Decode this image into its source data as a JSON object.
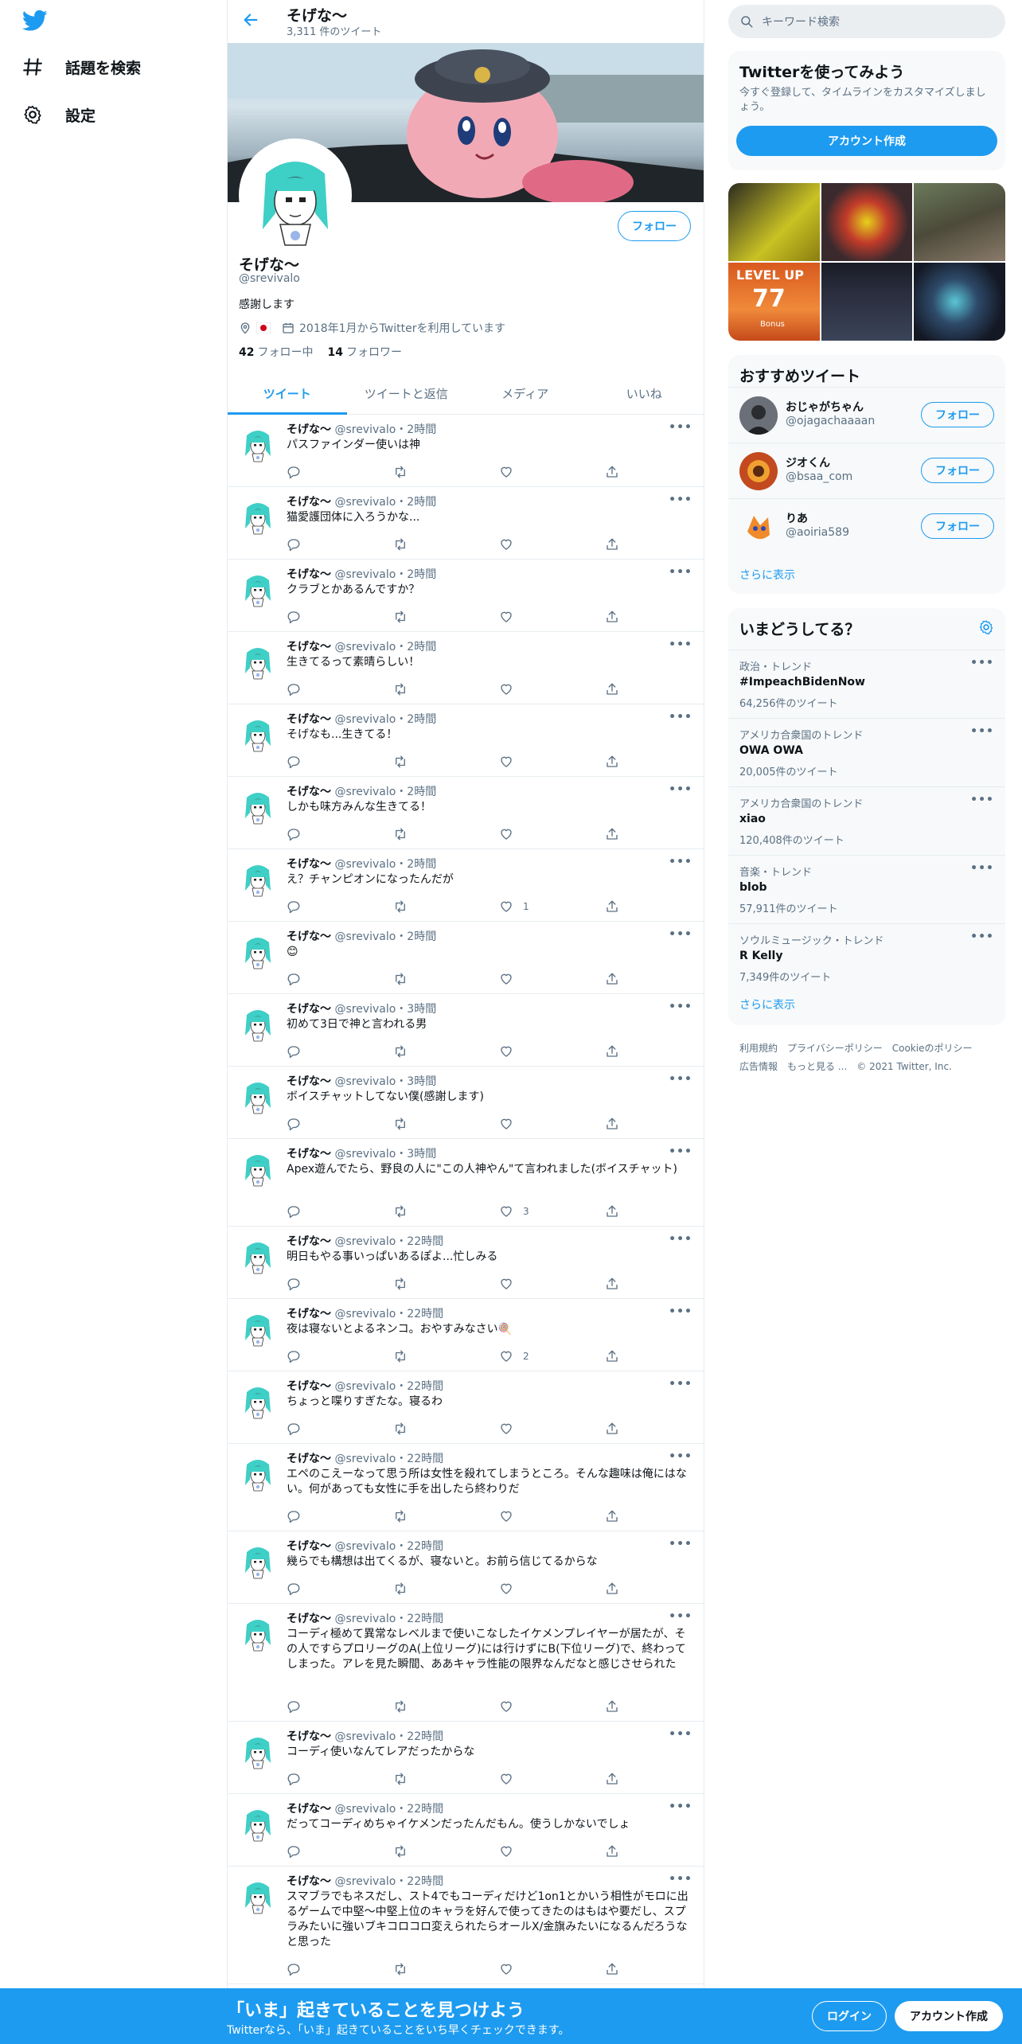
{
  "nav": {
    "items": [
      {
        "label": "話題を検索",
        "icon": "hashtag-icon"
      },
      {
        "label": "設定",
        "icon": "gear-icon"
      }
    ]
  },
  "profile": {
    "display_name": "そげな〜",
    "tweet_count": "3,311 件のツイート",
    "handle": "@srevivalo",
    "bio": "感謝します",
    "joined": "2018年1月からTwitterを利用しています",
    "following_count": "42",
    "following_label": "フォロー中",
    "followers_count": "14",
    "followers_label": "フォロワー",
    "follow_label": "フォロー",
    "tabs": [
      "ツイート",
      "ツイートと返信",
      "メディア",
      "いいね"
    ]
  },
  "tweets": [
    {
      "name": "そげな〜",
      "meta": "@srevivalo・2時間",
      "text": "パスファインダー使いは神",
      "likes": ""
    },
    {
      "name": "そげな〜",
      "meta": "@srevivalo・2時間",
      "text": "猫愛護団体に入ろうかな...",
      "likes": ""
    },
    {
      "name": "そげな〜",
      "meta": "@srevivalo・2時間",
      "text": "クラブとかあるんですか？",
      "likes": ""
    },
    {
      "name": "そげな〜",
      "meta": "@srevivalo・2時間",
      "text": "生きてるって素晴らしい！",
      "likes": ""
    },
    {
      "name": "そげな〜",
      "meta": "@srevivalo・2時間",
      "text": "そげなも...生きてる！",
      "likes": ""
    },
    {
      "name": "そげな〜",
      "meta": "@srevivalo・2時間",
      "text": "しかも味方みんな生きてる！",
      "likes": ""
    },
    {
      "name": "そげな〜",
      "meta": "@srevivalo・2時間",
      "text": "え？チャンピオンになったんだが",
      "likes": "1"
    },
    {
      "name": "そげな〜",
      "meta": "@srevivalo・2時間",
      "text": "😊",
      "likes": ""
    },
    {
      "name": "そげな〜",
      "meta": "@srevivalo・3時間",
      "text": "初めて3日で神と言われる男",
      "likes": ""
    },
    {
      "name": "そげな〜",
      "meta": "@srevivalo・3時間",
      "text": "ボイスチャットしてない僕(感謝します)",
      "likes": ""
    },
    {
      "name": "そげな〜",
      "meta": "@srevivalo・3時間",
      "text": "Apex遊んでたら、野良の人に\"この人神やん\"て言われました(ボイスチャット)",
      "likes": "3"
    },
    {
      "name": "そげな〜",
      "meta": "@srevivalo・22時間",
      "text": "明日もやる事いっぱいあるぽよ...忙しみる",
      "likes": ""
    },
    {
      "name": "そげな〜",
      "meta": "@srevivalo・22時間",
      "text": "夜は寝ないとよるネンコ。おやすみなさい🍭",
      "likes": "2"
    },
    {
      "name": "そげな〜",
      "meta": "@srevivalo・22時間",
      "text": "ちょっと喋りすぎたな。寝るわ",
      "likes": ""
    },
    {
      "name": "そげな〜",
      "meta": "@srevivalo・22時間",
      "text": "エペのこえーなって思う所は女性を殺れてしまうところ。そんな趣味は俺にはない。何があっても女性に手を出したら終わりだ",
      "likes": ""
    },
    {
      "name": "そげな〜",
      "meta": "@srevivalo・22時間",
      "text": "幾らでも構想は出てくるが、寝ないと。お前ら信じてるからな",
      "likes": ""
    },
    {
      "name": "そげな〜",
      "meta": "@srevivalo・22時間",
      "text": "コーディ極めて異常なレベルまで使いこなしたイケメンプレイヤーが居たが、その人ですらプロリーグのA(上位リーグ)には行けずにB(下位リーグ)で、終わってしまった。アレを見た瞬間、ああキャラ性能の限界なんだなと感じさせられた",
      "likes": ""
    },
    {
      "name": "そげな〜",
      "meta": "@srevivalo・22時間",
      "text": "コーディ使いなんてレアだったからな",
      "likes": ""
    },
    {
      "name": "そげな〜",
      "meta": "@srevivalo・22時間",
      "text": "だってコーディめちゃイケメンだったんだもん。使うしかないでしょ",
      "likes": ""
    },
    {
      "name": "そげな〜",
      "meta": "@srevivalo・22時間",
      "text": "スマブラでもネスだし、スト4でもコーディだけど1on1とかいう相性がモロに出るゲームで中堅〜中堅上位のキャラを好んで使ってきたのはもはや要だし、スプラみたいに強いブキコロコロ変えられたらオールX/金旗みたいになるんだろうなと思った",
      "likes": ""
    }
  ],
  "right": {
    "search_placeholder": "キーワード検索",
    "try": {
      "title": "Twitterを使ってみよう",
      "subtitle": "今すぐ登録して、タイムラインをカスタマイズしましょう。",
      "button": "アカウント作成"
    },
    "media_level_text": "LEVEL UP",
    "media_level_num": "77",
    "media_bonus": "Bonus",
    "recommended": {
      "title": "おすすめツイート",
      "users": [
        {
          "name": "おじゃがちゃん",
          "handle": "@ojagachaaaan",
          "button": "フォロー"
        },
        {
          "name": "ジオくん",
          "handle": "@bsaa_com",
          "button": "フォロー"
        },
        {
          "name": "りあ",
          "handle": "@aoiria589",
          "button": "フォロー"
        }
      ],
      "more": "さらに表示"
    },
    "trends": {
      "title": "いまどうしてる？",
      "items": [
        {
          "context": "政治・トレンド",
          "name": "#ImpeachBidenNow",
          "count": "64,256件のツイート"
        },
        {
          "context": "アメリカ合衆国のトレンド",
          "name": "OWA OWA",
          "count": "20,005件のツイート"
        },
        {
          "context": "アメリカ合衆国のトレンド",
          "name": "xiao",
          "count": "120,408件のツイート"
        },
        {
          "context": "音楽・トレンド",
          "name": "blob",
          "count": "57,911件のツイート"
        },
        {
          "context": "ソウルミュージック・トレンド",
          "name": "R Kelly",
          "count": "7,349件のツイート"
        }
      ],
      "more": "さらに表示"
    },
    "footer": [
      "利用規約",
      "プライバシーポリシー",
      "Cookieのポリシー",
      "広告情報",
      "もっと見る ...",
      "© 2021 Twitter, Inc."
    ]
  },
  "bottom": {
    "title": "「いま」起きていることを見つけよう",
    "subtitle": "Twitterなら、「いま」起きていることをいち早くチェックできます。",
    "login": "ログイン",
    "signup": "アカウント作成"
  },
  "colors": {
    "accent": "#1d9bf0",
    "text": "#0f1419",
    "muted": "#5b7083",
    "border": "#e6ecf0"
  }
}
